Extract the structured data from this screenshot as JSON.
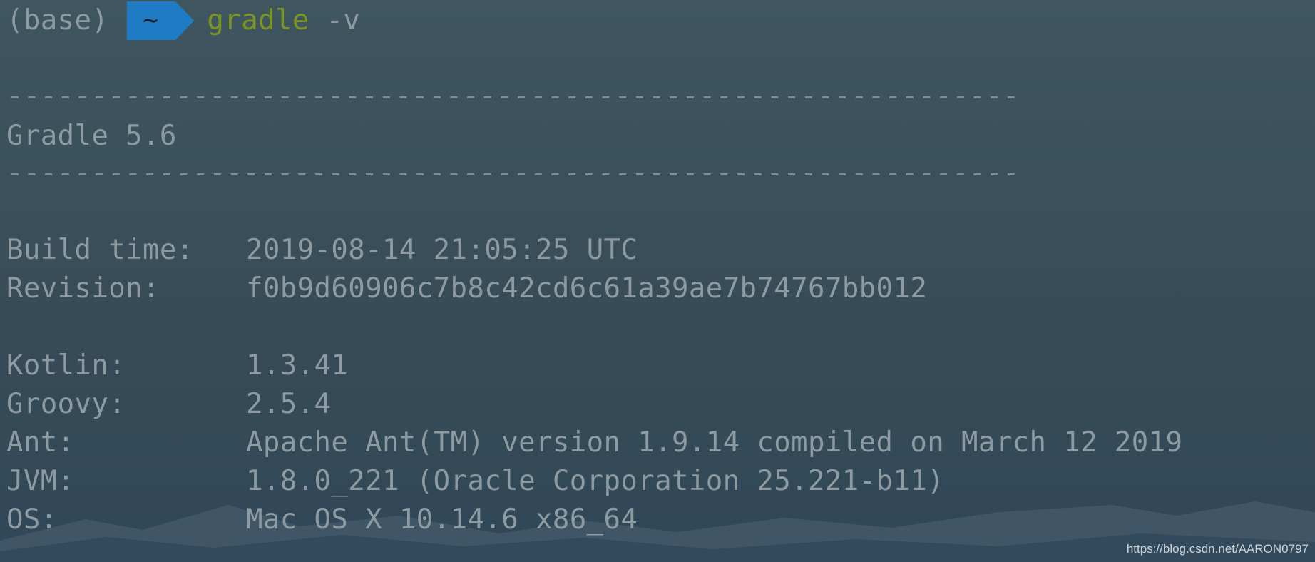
{
  "prompt": {
    "env": "(base)",
    "dir": "~",
    "command": "gradle",
    "arg": "-v"
  },
  "output": {
    "rule": "------------------------------------------------------------",
    "title": "Gradle 5.6",
    "rows": [
      {
        "key": "Build time:",
        "value": "2019-08-14 21:05:25 UTC"
      },
      {
        "key": "Revision:",
        "value": "f0b9d60906c7b8c42cd6c61a39ae7b74767bb012"
      },
      {
        "key": "Kotlin:",
        "value": "1.3.41"
      },
      {
        "key": "Groovy:",
        "value": "2.5.4"
      },
      {
        "key": "Ant:",
        "value": "Apache Ant(TM) version 1.9.14 compiled on March 12 2019"
      },
      {
        "key": "JVM:",
        "value": "1.8.0_221 (Oracle Corporation 25.221-b11)"
      },
      {
        "key": "OS:",
        "value": "Mac OS X 10.14.6 x86_64"
      }
    ]
  },
  "watermark": "https://blog.csdn.net/AARON0797",
  "colors": {
    "background": "#3a515c",
    "text": "#8d9aa1",
    "command": "#7d9421",
    "dir_segment": "#1f7bc4"
  }
}
